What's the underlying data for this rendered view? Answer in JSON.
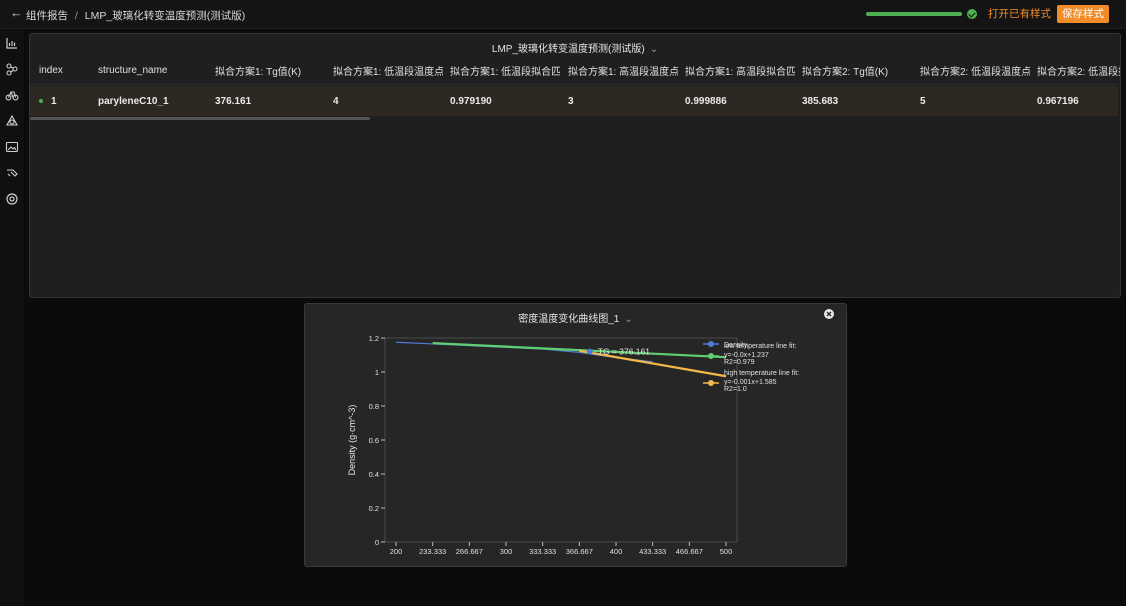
{
  "header": {
    "breadcrumb_parent": "组件报告",
    "breadcrumb_sep": "/",
    "breadcrumb_current": "LMP_玻璃化转变温度预测(测试版)",
    "progress": 1.0,
    "open_style_label": "打开已有样式",
    "save_style_label": "保存样式",
    "accent_color": "#f28c28",
    "progress_color": "#4caf50"
  },
  "sidebar": {
    "icons": [
      "bar-chart-icon",
      "molecule-icon",
      "bike-icon",
      "polymer-icon",
      "image-icon",
      "pen-icon",
      "cycle-icon"
    ]
  },
  "table": {
    "title": "LMP_玻璃化转变温度预测(测试版)",
    "columns": [
      "index",
      "structure_name",
      "拟合方案1: Tg值(K)",
      "拟合方案1: 低温段温度点...",
      "拟合方案1: 低温段拟合匹...",
      "拟合方案1: 高温段温度点...",
      "拟合方案1: 高温段拟合匹...",
      "拟合方案2: Tg值(K)",
      "拟合方案2: 低温段温度点...",
      "拟合方案2: 低温段拟合"
    ],
    "rows": [
      [
        "1",
        "paryleneC10_1",
        "376.161",
        "4",
        "0.979190",
        "3",
        "0.999886",
        "385.683",
        "5",
        "0.967196"
      ]
    ]
  },
  "chart_panel": {
    "title": "密度温度变化曲线图_1"
  },
  "chart_data": {
    "type": "line",
    "ylabel": "Density (g·cm^-3)",
    "xlim": [
      190,
      510
    ],
    "ylim": [
      0,
      1.2
    ],
    "x_ticks": [
      "200",
      "233.333",
      "266.667",
      "300",
      "333.333",
      "366.667",
      "400",
      "433.333",
      "466.667",
      "500"
    ],
    "y_ticks": [
      "0",
      "0.2",
      "0.4",
      "0.6",
      "0.8",
      "1",
      "1.2"
    ],
    "series": [
      {
        "name": "Density",
        "color": "#4f7bd9",
        "x": [
          200,
          233.333,
          266.667,
          300,
          333.333,
          366.667,
          400,
          433.333
        ],
        "y": [
          1.175,
          1.165,
          1.155,
          1.145,
          1.135,
          1.115,
          1.085,
          1.06
        ]
      },
      {
        "name": "low temperature line fit:",
        "color": "#5fd06f",
        "x": [
          233.333,
          500
        ],
        "y": [
          1.17,
          1.087
        ]
      },
      {
        "name": "high temperature line fit:",
        "color": "#f2b84b",
        "x": [
          366.667,
          500
        ],
        "y": [
          1.125,
          0.975
        ]
      }
    ],
    "tg_marker": {
      "x": 376.161,
      "y": 1.12,
      "label": "TG = 376.161"
    },
    "legend": [
      {
        "label": "Density",
        "color": "#4f7bd9"
      },
      {
        "label": "low temperature line fit:",
        "color": "#5fd06f",
        "lines": [
          "y=-0.0x+1.237",
          "R2=0.979"
        ]
      },
      {
        "label": "high temperature line fit:",
        "color": "#f2b84b",
        "lines": [
          "y=-0.001x+1.585",
          "R2=1.0"
        ]
      }
    ],
    "legend_position": "top-right",
    "grid": false
  }
}
